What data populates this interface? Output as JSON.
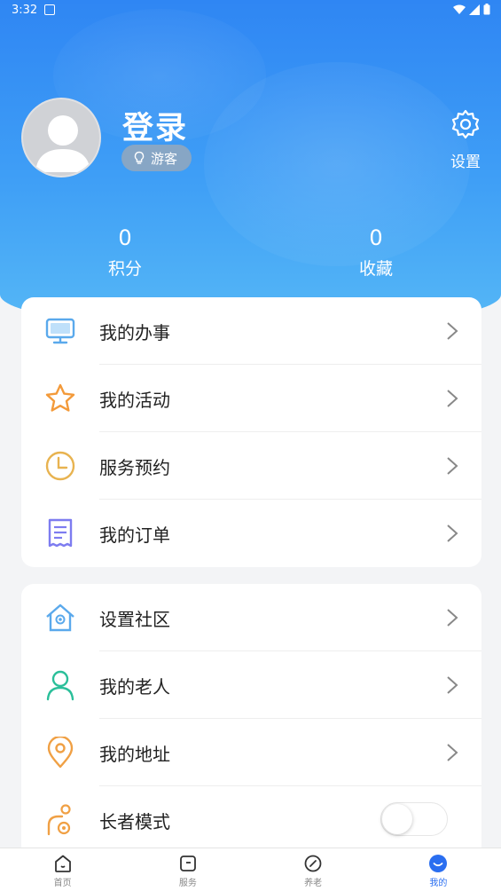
{
  "status_bar": {
    "time": "3:32"
  },
  "profile": {
    "login_label": "登录",
    "guest_label": "游客",
    "settings_label": "设置"
  },
  "stats": [
    {
      "value": "0",
      "label": "积分"
    },
    {
      "value": "0",
      "label": "收藏"
    }
  ],
  "menu_group_1": [
    {
      "label": "我的办事",
      "icon": "monitor-icon",
      "color": "#5aa9ec"
    },
    {
      "label": "我的活动",
      "icon": "star-icon",
      "color": "#f39a3a"
    },
    {
      "label": "服务预约",
      "icon": "clock-icon",
      "color": "#e8b350"
    },
    {
      "label": "我的订单",
      "icon": "receipt-icon",
      "color": "#7d7cf0"
    }
  ],
  "menu_group_2": [
    {
      "label": "设置社区",
      "icon": "community-house-icon",
      "color": "#5aa9ec"
    },
    {
      "label": "我的老人",
      "icon": "person-icon",
      "color": "#2bbf9a"
    },
    {
      "label": "我的地址",
      "icon": "location-pin-icon",
      "color": "#f0a044"
    },
    {
      "label": "长者模式",
      "icon": "elder-mode-icon",
      "color": "#f0a044",
      "toggle_on": false
    }
  ],
  "tabs": [
    {
      "label": "首页",
      "icon": "home-icon"
    },
    {
      "label": "服务",
      "icon": "service-icon"
    },
    {
      "label": "养老",
      "icon": "elderly-care-icon"
    },
    {
      "label": "我的",
      "icon": "profile-icon",
      "active": true
    }
  ],
  "colors": {
    "header_blue": "#3a93f5",
    "tab_active": "#2a6ef0"
  }
}
